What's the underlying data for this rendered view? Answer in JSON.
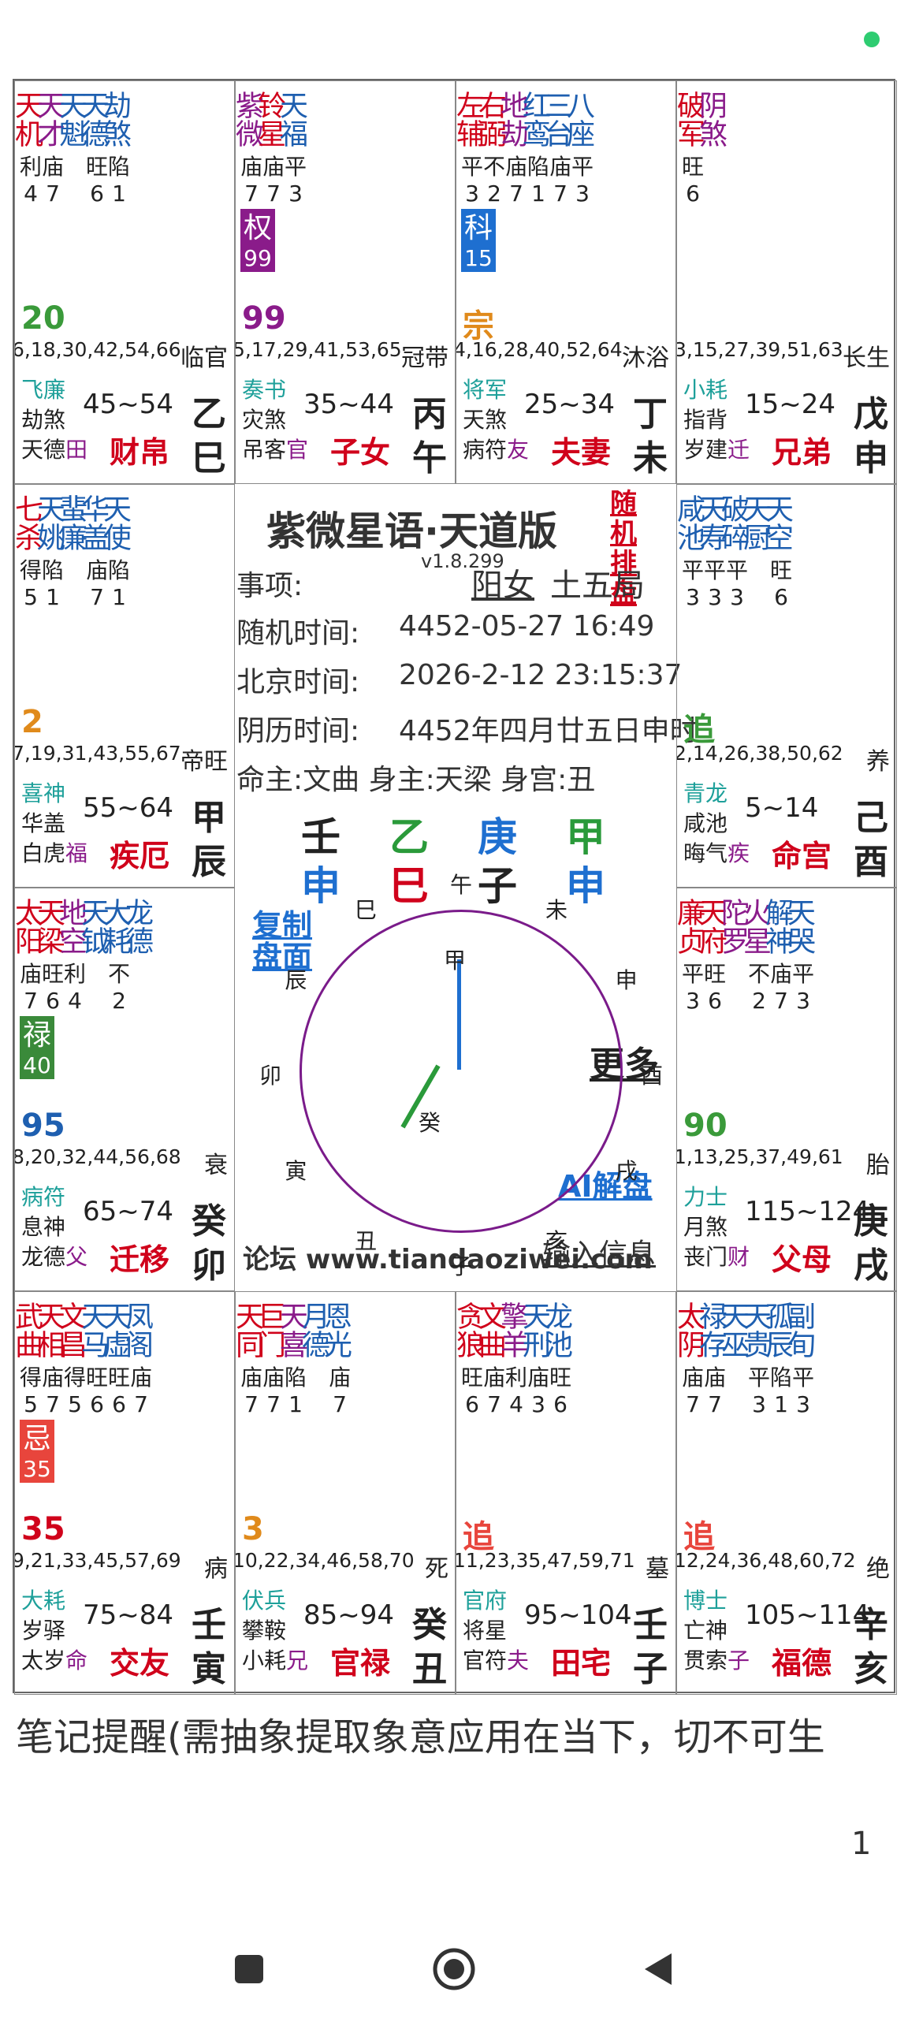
{
  "status": {
    "dot_color": "#2ecc71"
  },
  "cells": [
    {
      "id": "si",
      "col": 0,
      "row": 0,
      "stars": [
        {
          "t": "天机",
          "c": "#d0021b"
        },
        {
          "t": "天才",
          "c": "#8a1b8a"
        },
        {
          "t": "天魁",
          "c": "#1e5fb0"
        },
        {
          "t": "天德",
          "c": "#1e5fb0"
        },
        {
          "t": "劫煞",
          "c": "#1e5fb0"
        }
      ],
      "bright": [
        "利4",
        "庙7",
        "",
        "旺6",
        "陷1"
      ],
      "tag": null,
      "num": "20",
      "num_color": "#3a9a3a",
      "ages": "6,18,30,42,54,66",
      "stage": "临官",
      "g1": {
        "t": "飞廉",
        "c": "#1ea09a"
      },
      "g2": "劫煞",
      "g3": "天德",
      "g3b": "田",
      "range": "45~54",
      "palace": "财帛",
      "stem": "乙",
      "branch": "巳"
    },
    {
      "id": "wu",
      "col": 1,
      "row": 0,
      "stars": [
        {
          "t": "紫微",
          "c": "#8a1b8a"
        },
        {
          "t": "铃星",
          "c": "#d0021b"
        },
        {
          "t": "天福",
          "c": "#1e5fb0"
        }
      ],
      "bright": [
        "庙7",
        "庙7",
        "平3"
      ],
      "tag": {
        "t": "权",
        "n": "99",
        "c": "#8a1b8a"
      },
      "num": "99",
      "num_color": "#8a1b8a",
      "ages": "5,17,29,41,53,65",
      "stage": "冠带",
      "g1": {
        "t": "奏书",
        "c": "#1ea09a"
      },
      "g2": "灾煞",
      "g3": "吊客",
      "g3b": "官",
      "range": "35~44",
      "palace": "子女",
      "stem": "丙",
      "branch": "午"
    },
    {
      "id": "wei",
      "col": 2,
      "row": 0,
      "stars": [
        {
          "t": "左辅",
          "c": "#d0021b"
        },
        {
          "t": "右弼",
          "c": "#d0021b"
        },
        {
          "t": "地劫",
          "c": "#8a1b8a"
        },
        {
          "t": "红鸾",
          "c": "#1e5fb0"
        },
        {
          "t": "三台",
          "c": "#1e5fb0"
        },
        {
          "t": "八座",
          "c": "#1e5fb0"
        }
      ],
      "bright": [
        "平3",
        "不2",
        "庙7",
        "陷1",
        "庙7",
        "平3"
      ],
      "tag": {
        "t": "科",
        "n": "15",
        "c": "#1e6fd0"
      },
      "num": "宗",
      "num_color": "#e08a1b",
      "ages": "4,16,28,40,52,64",
      "stage": "沐浴",
      "g1": {
        "t": "将军",
        "c": "#1ea09a"
      },
      "g2": "天煞",
      "g3": "病符",
      "g3b": "友",
      "range": "25~34",
      "palace": "夫妻",
      "stem": "丁",
      "branch": "未"
    },
    {
      "id": "shen",
      "col": 3,
      "row": 0,
      "stars": [
        {
          "t": "破军",
          "c": "#d0021b"
        },
        {
          "t": "阴煞",
          "c": "#8a1b8a"
        }
      ],
      "bright": [
        "旺6"
      ],
      "tag": null,
      "num": "",
      "num_color": "#222",
      "ages": "3,15,27,39,51,63",
      "stage": "长生",
      "g1": {
        "t": "小耗",
        "c": "#1ea09a"
      },
      "g2": "指背",
      "g3": "岁建",
      "g3b": "迁",
      "range": "15~24",
      "palace": "兄弟",
      "stem": "戊",
      "branch": "申"
    },
    {
      "id": "chen",
      "col": 0,
      "row": 1,
      "stars": [
        {
          "t": "七杀",
          "c": "#d0021b"
        },
        {
          "t": "天姚",
          "c": "#1e5fb0"
        },
        {
          "t": "蜚廉",
          "c": "#1e5fb0"
        },
        {
          "t": "华盖",
          "c": "#1e5fb0"
        },
        {
          "t": "天使",
          "c": "#1e5fb0"
        }
      ],
      "bright": [
        "得5",
        "陷1",
        "",
        "庙7",
        "陷1"
      ],
      "tag": null,
      "num": "2",
      "num_color": "#e08a1b",
      "ages": "7,19,31,43,55,67",
      "stage": "帝旺",
      "g1": {
        "t": "喜神",
        "c": "#1ea09a"
      },
      "g2": "华盖",
      "g3": "白虎",
      "g3b": "福",
      "range": "55~64",
      "palace": "疾厄",
      "stem": "甲",
      "branch": "辰"
    },
    {
      "id": "you",
      "col": 3,
      "row": 1,
      "stars": [
        {
          "t": "咸池",
          "c": "#1e5fb0"
        },
        {
          "t": "天寿",
          "c": "#1e5fb0"
        },
        {
          "t": "破碎",
          "c": "#1e5fb0"
        },
        {
          "t": "天厨",
          "c": "#1e5fb0"
        },
        {
          "t": "天空",
          "c": "#1e5fb0"
        }
      ],
      "bright": [
        "平3",
        "平3",
        "平3",
        "",
        "旺6"
      ],
      "tag": null,
      "num": "追",
      "num_color": "#3a9a3a",
      "ages": "2,14,26,38,50,62",
      "stage": "养",
      "g1": {
        "t": "青龙",
        "c": "#1ea09a"
      },
      "g2": "咸池",
      "g3": "晦气",
      "g3b": "疾",
      "range": "5~14",
      "palace": "命宫",
      "stem": "己",
      "branch": "酉"
    },
    {
      "id": "mao",
      "col": 0,
      "row": 2,
      "stars": [
        {
          "t": "太阳",
          "c": "#d0021b"
        },
        {
          "t": "天梁",
          "c": "#d0021b"
        },
        {
          "t": "地空",
          "c": "#8a1b8a"
        },
        {
          "t": "天钺",
          "c": "#1e5fb0"
        },
        {
          "t": "大耗",
          "c": "#1e5fb0"
        },
        {
          "t": "龙德",
          "c": "#1e5fb0"
        }
      ],
      "bright": [
        "庙7",
        "旺6",
        "利4",
        "",
        "不2",
        ""
      ],
      "tag": {
        "t": "禄",
        "n": "40",
        "c": "#3a8a3a"
      },
      "num": "95",
      "num_color": "#1e5fb0",
      "ages": "8,20,32,44,56,68",
      "stage": "衰",
      "g1": {
        "t": "病符",
        "c": "#1ea09a"
      },
      "g2": "息神",
      "g3": "龙德",
      "g3b": "父",
      "range": "65~74",
      "palace": "迁移",
      "stem": "癸",
      "branch": "卯"
    },
    {
      "id": "xu",
      "col": 3,
      "row": 2,
      "stars": [
        {
          "t": "廉贞",
          "c": "#d0021b"
        },
        {
          "t": "天府",
          "c": "#d0021b"
        },
        {
          "t": "陀罗",
          "c": "#8a1b8a"
        },
        {
          "t": "火星",
          "c": "#8a1b8a"
        },
        {
          "t": "解神",
          "c": "#1e5fb0"
        },
        {
          "t": "天哭",
          "c": "#1e5fb0"
        }
      ],
      "bright": [
        "平3",
        "旺6",
        "",
        "不2",
        "庙7",
        "平3"
      ],
      "tag": null,
      "num": "90",
      "num_color": "#3a9a3a",
      "ages": "1,13,25,37,49,61",
      "stage": "胎",
      "g1": {
        "t": "力士",
        "c": "#1ea09a"
      },
      "g2": "月煞",
      "g3": "丧门",
      "g3b": "财",
      "range": "115~124",
      "palace": "父母",
      "stem": "庚",
      "branch": "戌"
    },
    {
      "id": "yin",
      "col": 0,
      "row": 3,
      "stars": [
        {
          "t": "武曲",
          "c": "#d0021b"
        },
        {
          "t": "天相",
          "c": "#d0021b"
        },
        {
          "t": "文昌",
          "c": "#d0021b"
        },
        {
          "t": "天马",
          "c": "#1e5fb0"
        },
        {
          "t": "天虚",
          "c": "#1e5fb0"
        },
        {
          "t": "凤阁",
          "c": "#1e5fb0"
        }
      ],
      "bright": [
        "得5",
        "庙7",
        "得5",
        "旺6",
        "旺6",
        "庙7"
      ],
      "tag": {
        "t": "忌",
        "n": "35",
        "c": "#e8453c"
      },
      "num": "35",
      "num_color": "#d0021b",
      "ages": "9,21,33,45,57,69",
      "stage": "病",
      "g1": {
        "t": "大耗",
        "c": "#1ea09a"
      },
      "g2": "岁驿",
      "g3": "太岁",
      "g3b": "命",
      "range": "75~84",
      "palace": "交友",
      "stem": "壬",
      "branch": "寅"
    },
    {
      "id": "chou",
      "col": 1,
      "row": 3,
      "stars": [
        {
          "t": "天同",
          "c": "#d0021b"
        },
        {
          "t": "巨门",
          "c": "#d0021b"
        },
        {
          "t": "天喜",
          "c": "#8a1b8a"
        },
        {
          "t": "月德",
          "c": "#1e5fb0"
        },
        {
          "t": "恩光",
          "c": "#1e5fb0"
        }
      ],
      "bright": [
        "庙7",
        "庙7",
        "陷1",
        "",
        "庙7"
      ],
      "tag": null,
      "num": "3",
      "num_color": "#e08a1b",
      "ages": "10,22,34,46,58,70",
      "stage": "死",
      "g1": {
        "t": "伏兵",
        "c": "#1ea09a"
      },
      "g2": "攀鞍",
      "g3": "小耗",
      "g3b": "兄",
      "range": "85~94",
      "palace": "官禄",
      "stem": "癸",
      "branch": "丑"
    },
    {
      "id": "zi",
      "col": 2,
      "row": 3,
      "stars": [
        {
          "t": "贪狼",
          "c": "#d0021b"
        },
        {
          "t": "文曲",
          "c": "#d0021b"
        },
        {
          "t": "擎羊",
          "c": "#8a1b8a"
        },
        {
          "t": "天刑",
          "c": "#1e5fb0"
        },
        {
          "t": "龙池",
          "c": "#1e5fb0"
        }
      ],
      "bright": [
        "旺6",
        "庙7",
        "利4",
        "庙3",
        "旺6"
      ],
      "tag": null,
      "num": "追",
      "num_color": "#e8453c",
      "ages": "11,23,35,47,59,71",
      "stage": "墓",
      "g1": {
        "t": "官府",
        "c": "#1ea09a"
      },
      "g2": "将星",
      "g3": "官符",
      "g3b": "夫",
      "range": "95~104",
      "palace": "田宅",
      "stem": "壬",
      "branch": "子"
    },
    {
      "id": "hai",
      "col": 3,
      "row": 3,
      "stars": [
        {
          "t": "太阴",
          "c": "#d0021b"
        },
        {
          "t": "禄存",
          "c": "#1e5fb0"
        },
        {
          "t": "天巫",
          "c": "#1e5fb0"
        },
        {
          "t": "天贵",
          "c": "#1e5fb0"
        },
        {
          "t": "孤辰",
          "c": "#1e5fb0"
        },
        {
          "t": "副旬",
          "c": "#1e5fb0"
        }
      ],
      "bright": [
        "庙7",
        "庙7",
        "",
        "平3",
        "陷1",
        "平3"
      ],
      "tag": null,
      "num": "追",
      "num_color": "#e8453c",
      "ages": "12,24,36,48,60,72",
      "stage": "绝",
      "g1": {
        "t": "博士",
        "c": "#1ea09a"
      },
      "g2": "亡神",
      "g3": "贯索",
      "g3b": "子",
      "range": "105~114",
      "palace": "福德",
      "stem": "辛",
      "branch": "亥"
    }
  ],
  "center": {
    "title": "紫微星语·天道版",
    "version": "v1.8.299",
    "random_btn": "随机排盘",
    "item_label": "事项:",
    "gender": "阳女",
    "bureau": "土五局",
    "random_time_label": "随机时间:",
    "random_time": "4452-05-27 16:49",
    "beijing_label": "北京时间:",
    "beijing_time": "2026-2-12 23:15:37",
    "lunar_label": "阴历时间:",
    "lunar_time": "4452年四月廿五日申时",
    "ming": "命主:文曲 身主:天梁 身宫:丑",
    "stems": [
      {
        "t": "壬",
        "c": "#222"
      },
      {
        "t": "乙",
        "c": "#2a9a3a"
      },
      {
        "t": "庚",
        "c": "#1e6fd0"
      },
      {
        "t": "甲",
        "c": "#2a9a3a"
      }
    ],
    "branches": [
      {
        "t": "申",
        "c": "#1e6fd0"
      },
      {
        "t": "巳",
        "c": "#d0021b"
      },
      {
        "t": "子",
        "c": "#222"
      },
      {
        "t": "申",
        "c": "#1e6fd0"
      }
    ],
    "copy_btn": "复制盘面",
    "more_btn": "更多",
    "ai_btn": "AI解盘",
    "forum": "论坛 www.tiandaoziwei.com",
    "input_btn": "输入信息",
    "clock_hours": [
      "午",
      "未",
      "申",
      "酉",
      "戌",
      "亥",
      "子",
      "丑",
      "寅",
      "卯",
      "辰",
      "巳"
    ],
    "clock_inner": [
      "甲",
      "癸"
    ]
  },
  "note": "笔记提醒(需抽象提取象意应用在当下，切不可生",
  "page_num": "1"
}
